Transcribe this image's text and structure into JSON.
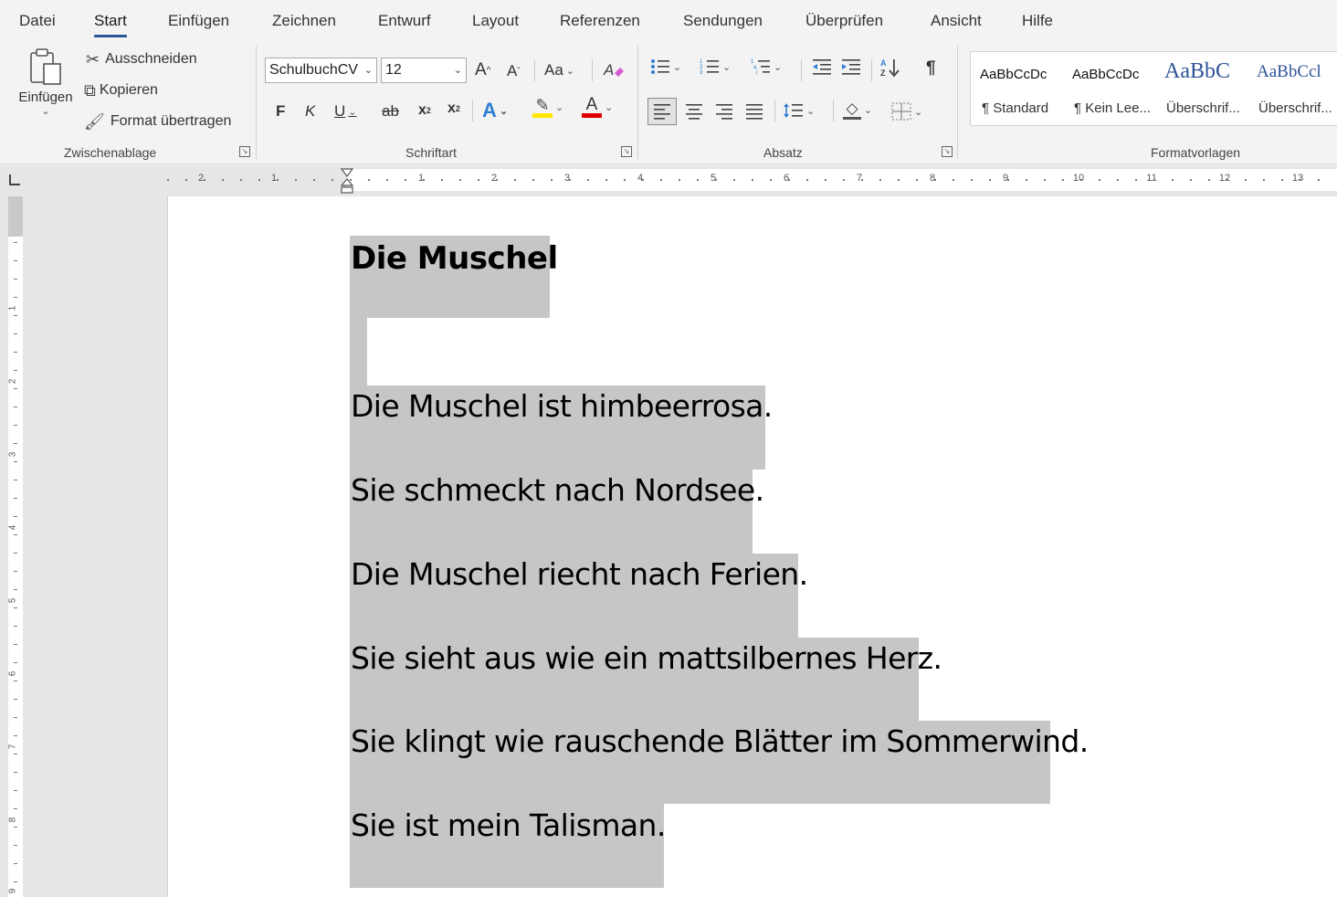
{
  "menu": {
    "tabs": [
      "Datei",
      "Start",
      "Einfügen",
      "Zeichnen",
      "Entwurf",
      "Layout",
      "Referenzen",
      "Sendungen",
      "Überprüfen",
      "Ansicht",
      "Hilfe"
    ],
    "active": "Start"
  },
  "ribbon": {
    "clipboard": {
      "paste_label": "Einfügen",
      "cut_label": "Ausschneiden",
      "copy_label": "Kopieren",
      "format_painter_label": "Format übertragen",
      "group_label": "Zwischenablage"
    },
    "font": {
      "font_name": "SchulbuchCV",
      "font_size": "12",
      "grow": "A",
      "shrink": "A",
      "case": "Aa",
      "bold": "F",
      "italic": "K",
      "underline": "U",
      "strike": "ab",
      "subscript": "x",
      "superscript": "x",
      "text_effect": "A",
      "highlight_color": "#ffe600",
      "font_color": "#e00000",
      "font_color_letter": "A",
      "group_label": "Schriftart"
    },
    "paragraph": {
      "group_label": "Absatz",
      "pilcrow": "¶"
    },
    "styles": {
      "group_label": "Formatvorlagen",
      "items": [
        {
          "preview": "AaBbCcDc",
          "name": "¶ Standard"
        },
        {
          "preview": "AaBbCcDc",
          "name": "¶ Kein Lee..."
        },
        {
          "preview": "AaBbC",
          "name": "Überschrif..."
        },
        {
          "preview": "AaBbCcl",
          "name": "Überschrif..."
        }
      ]
    }
  },
  "ruler": {
    "left_numbers": [
      "2",
      "1"
    ],
    "right_numbers": [
      "1",
      "2",
      "3",
      "4",
      "5",
      "6",
      "7",
      "8",
      "9",
      "10",
      "11",
      "12",
      "13"
    ],
    "vertical_numbers": [
      "1",
      "2",
      "3",
      "4",
      "5",
      "6",
      "7",
      "8",
      "9"
    ]
  },
  "document": {
    "title": "Die Muschel",
    "lines": [
      "Die Muschel ist himbeerrosa.",
      "Sie schmeckt nach Nordsee.",
      "Die Muschel riecht nach Ferien.",
      "Sie sieht aus wie ein mattsilbernes Herz.",
      "Sie klingt wie rauschende Blätter im Sommerwind.",
      "Sie ist mein Talisman."
    ],
    "selection_color": "#c6c6c6",
    "accent": "#2b579a"
  }
}
